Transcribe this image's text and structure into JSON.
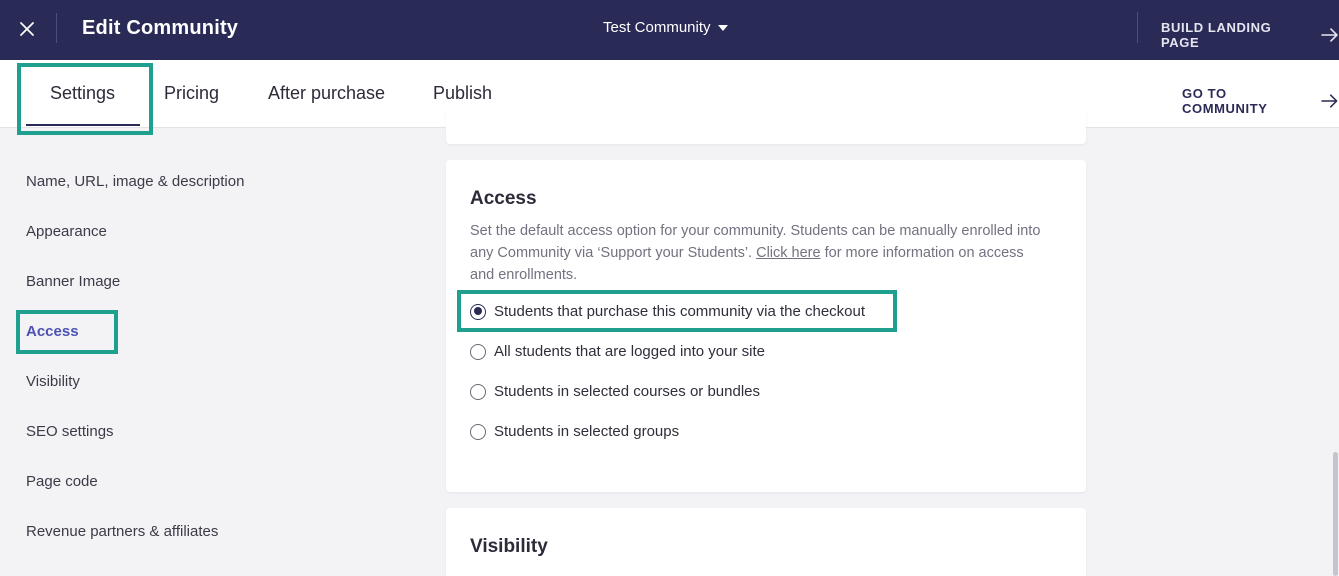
{
  "topbar": {
    "title": "Edit Community",
    "community_name": "Test Community",
    "build_link": "BUILD LANDING PAGE"
  },
  "tabs": [
    {
      "label": "Settings",
      "active": true
    },
    {
      "label": "Pricing",
      "active": false
    },
    {
      "label": "After purchase",
      "active": false
    },
    {
      "label": "Publish",
      "active": false
    }
  ],
  "goto_link": "GO TO COMMUNITY",
  "sidebar": {
    "items": [
      {
        "label": "Name, URL, image & description"
      },
      {
        "label": "Appearance"
      },
      {
        "label": "Banner Image"
      },
      {
        "label": "Access",
        "active": true
      },
      {
        "label": "Visibility"
      },
      {
        "label": "SEO settings"
      },
      {
        "label": "Page code"
      },
      {
        "label": "Revenue partners & affiliates"
      }
    ]
  },
  "access": {
    "title": "Access",
    "desc_before": "Set the default access option for your community. Students can be manually enrolled into any Community via ‘Support your Students’. ",
    "desc_link": "Click here",
    "desc_after": " for more information on access and enrollments.",
    "options": [
      {
        "label": "Students that purchase this community via the checkout",
        "checked": true
      },
      {
        "label": "All students that are logged into your site",
        "checked": false
      },
      {
        "label": "Students in selected courses or bundles",
        "checked": false
      },
      {
        "label": "Students in selected groups",
        "checked": false
      }
    ]
  },
  "visibility": {
    "title": "Visibility"
  },
  "colors": {
    "topbar_bg": "#2a2a57",
    "highlight": "#1fa08e",
    "active_sidebar": "#4b52b0"
  }
}
